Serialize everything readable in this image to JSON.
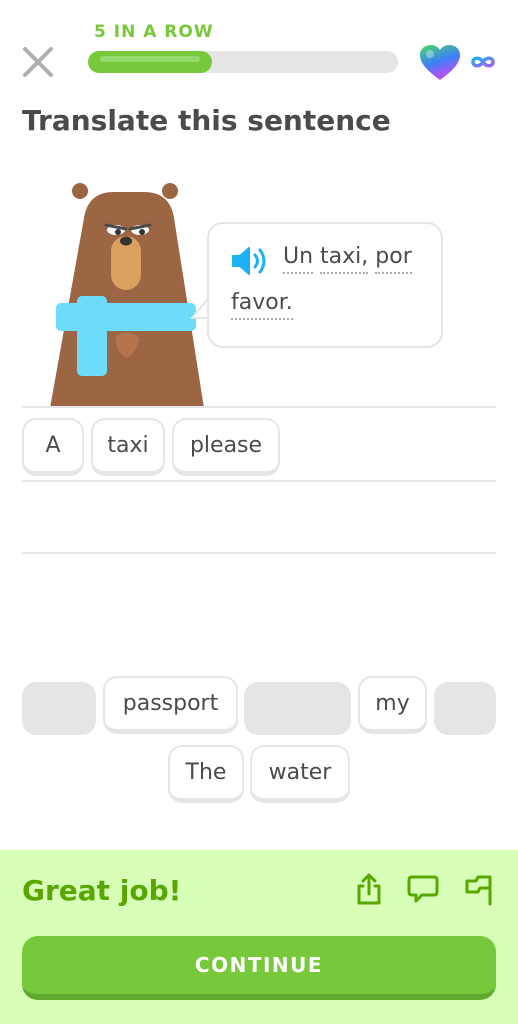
{
  "header": {
    "close_icon": "close-icon",
    "streak_label": "5 IN A ROW",
    "progress_fraction": 0.4,
    "hearts_icon": "heart-icon",
    "hearts_value": "infinity",
    "colors": {
      "accent": "#78c83c",
      "track": "#e5e5e5"
    }
  },
  "challenge": {
    "title": "Translate this sentence",
    "character": "bear",
    "prompt_words": [
      "Un",
      "taxi,",
      "por",
      "favor."
    ],
    "prompt_line1": "Un taxi, por",
    "prompt_line2": "favor.",
    "audio_icon": "speaker-icon"
  },
  "answer": {
    "selected_words": [
      "A",
      "taxi",
      "please"
    ]
  },
  "word_bank": {
    "row1": [
      {
        "label": "",
        "used": true
      },
      {
        "label": "passport",
        "used": false
      },
      {
        "label": "",
        "used": true
      },
      {
        "label": "my",
        "used": false
      },
      {
        "label": "",
        "used": true
      }
    ],
    "row2": [
      {
        "label": "The",
        "used": false
      },
      {
        "label": "water",
        "used": false
      }
    ]
  },
  "feedback": {
    "message": "Great job!",
    "icons": [
      "share-icon",
      "comment-icon",
      "report-flag-icon"
    ],
    "continue_label": "CONTINUE",
    "colors": {
      "background": "#d7ffb8",
      "text": "#58a700",
      "button": "#78c83c"
    }
  }
}
